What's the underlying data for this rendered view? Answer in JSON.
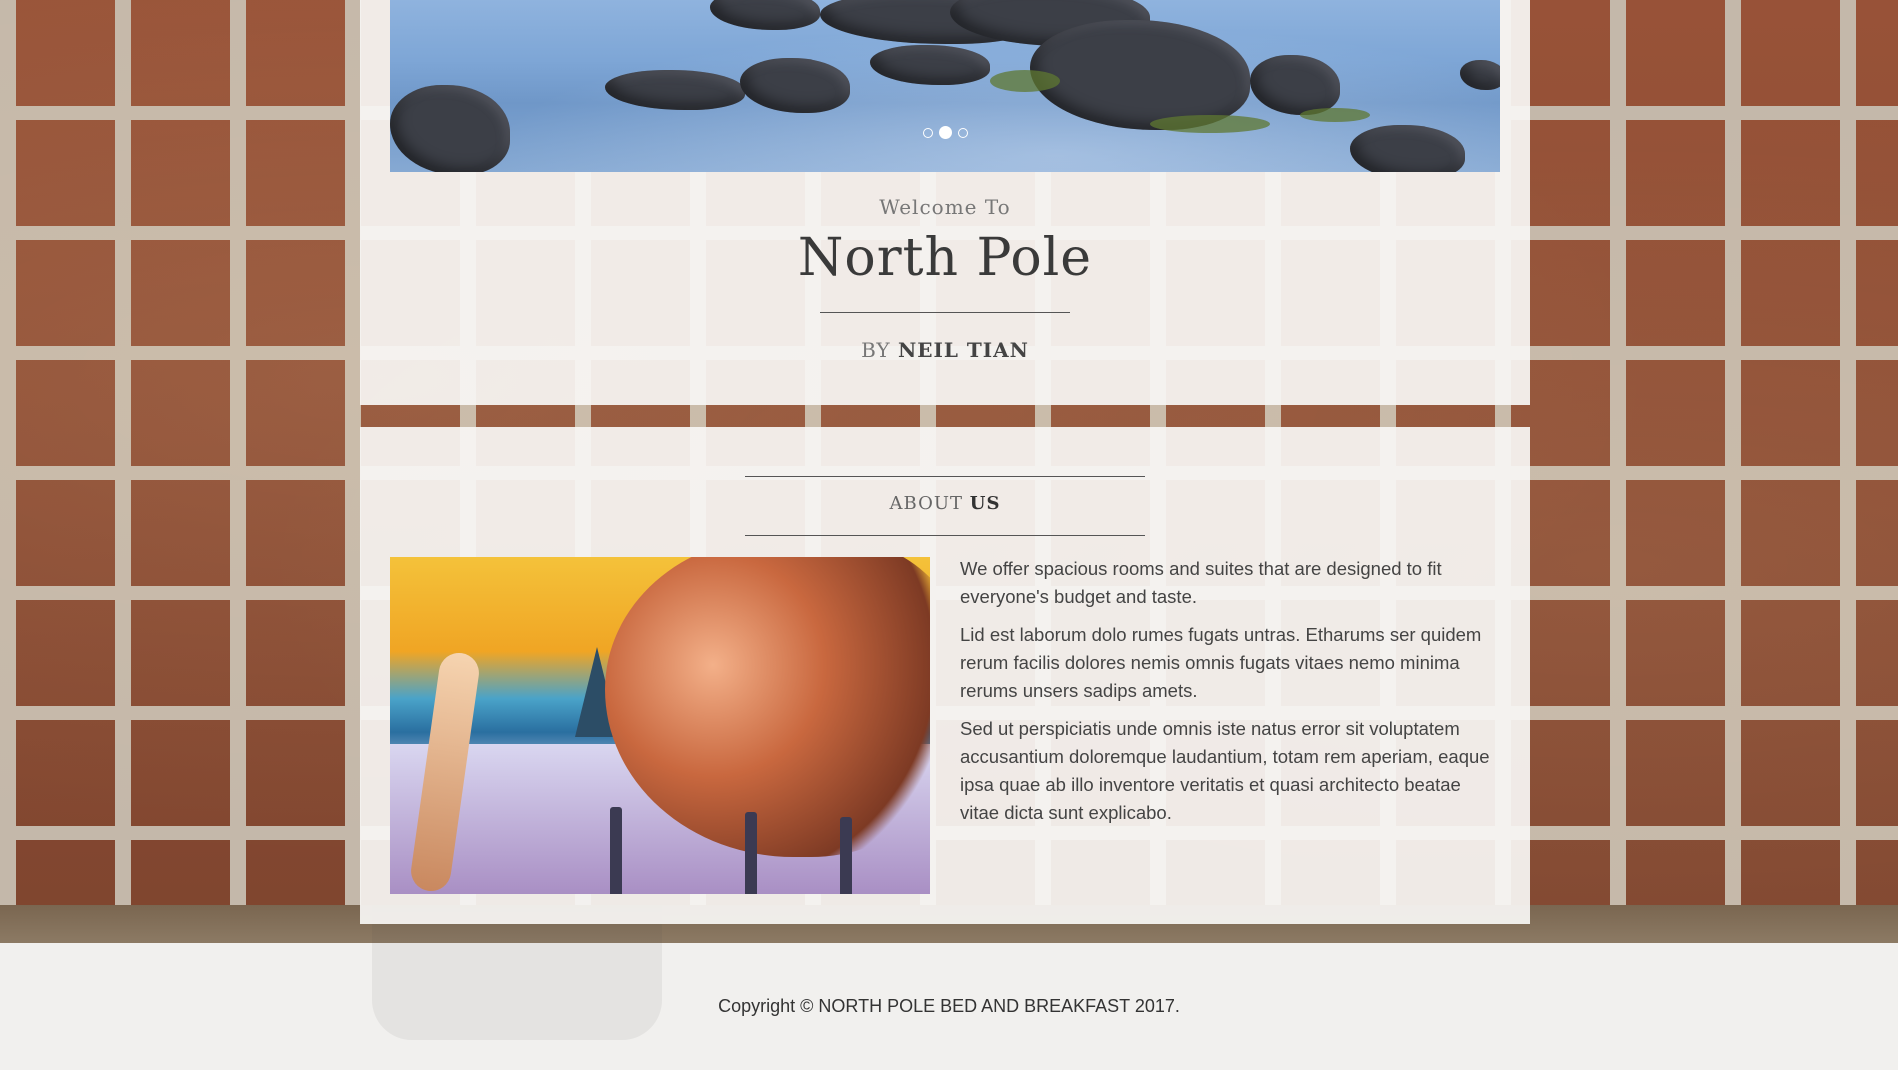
{
  "hero": {
    "carousel": {
      "indicators": [
        {
          "active": false
        },
        {
          "active": true
        },
        {
          "active": false
        }
      ]
    },
    "welcome": "Welcome To",
    "title": "North Pole",
    "byline_prefix": "BY",
    "byline_author": "NEIL TIAN"
  },
  "about": {
    "title_light": "ABOUT",
    "title_strong": "US",
    "paragraphs": [
      "We offer spacious rooms and suites that are designed to fit everyone's budget and taste.",
      "Lid est laborum dolo rumes fugats untras. Etharums ser quidem rerum facilis dolores nemis omnis fugats vitaes nemo minima rerums unsers sadips amets.",
      "Sed ut perspiciatis unde omnis iste natus error sit voluptatem accusantium doloremque laudantium, totam rem aperiam, eaque ipsa quae ab illo inventore veritatis et quasi architecto beatae vitae dicta sunt explicabo."
    ]
  },
  "footer": {
    "copyright": "Copyright © NORTH POLE BED AND BREAKFAST 2017."
  },
  "colors": {
    "panel_bg": "#f7f6f4",
    "brick": "#a35a3d",
    "mortar": "#c9bfb2",
    "text_dark": "#333333"
  }
}
